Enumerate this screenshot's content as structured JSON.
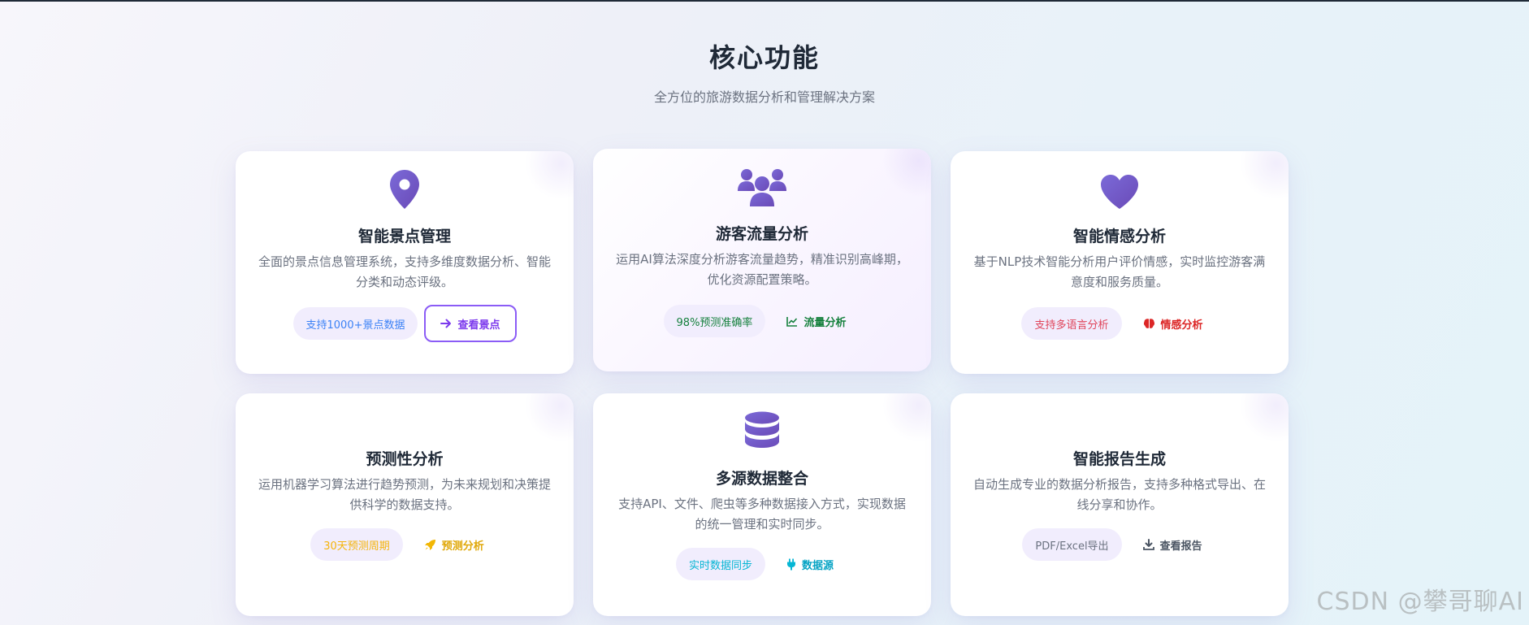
{
  "header": {
    "title": "核心功能",
    "subtitle": "全方位的旅游数据分析和管理解决方案"
  },
  "features": [
    {
      "title": "智能景点管理",
      "description": "全面的景点信息管理系统，支持多维度数据分析、智能分类和动态评级。",
      "icon": "map-pin-icon",
      "badge": "支持1000+景点数据",
      "badge_color": "#3b82f6",
      "action_icon": "arrow-right-icon",
      "action_label": "查看景点",
      "action_color": "#7c3aed"
    },
    {
      "title": "游客流量分析",
      "description": "运用AI算法深度分析游客流量趋势，精准识别高峰期，优化资源配置策略。",
      "icon": "users-icon",
      "badge": "98%预测准确率",
      "badge_color": "#15803d",
      "action_icon": "line-chart-icon",
      "action_label": "流量分析",
      "action_color": "#15803d"
    },
    {
      "title": "智能情感分析",
      "description": "基于NLP技术智能分析用户评价情感，实时监控游客满意度和服务质量。",
      "icon": "heart-icon",
      "badge": "支持多语言分析",
      "badge_color": "#e0445a",
      "action_icon": "brain-icon",
      "action_label": "情感分析",
      "action_color": "#dc2626"
    },
    {
      "title": "预测性分析",
      "description": "运用机器学习算法进行趋势预测，为未来规划和决策提供科学的数据支持。",
      "icon": "none",
      "badge": "30天预测周期",
      "badge_color": "#f5b40b",
      "action_icon": "rocket-icon",
      "action_label": "预测分析",
      "action_color": "#e0a80a"
    },
    {
      "title": "多源数据整合",
      "description": "支持API、文件、爬虫等多种数据接入方式，实现数据的统一管理和实时同步。",
      "icon": "database-icon",
      "badge": "实时数据同步",
      "badge_color": "#06b6d4",
      "action_icon": "plug-icon",
      "action_label": "数据源",
      "action_color": "#06a3c4"
    },
    {
      "title": "智能报告生成",
      "description": "自动生成专业的数据分析报告，支持多种格式导出、在线分享和协作。",
      "icon": "none",
      "badge": "PDF/Excel导出",
      "badge_color": "#6b7280",
      "action_icon": "download-icon",
      "action_label": "查看报告",
      "action_color": "#4b5563"
    }
  ],
  "colors": {
    "accent": "#7c5fd4",
    "accent_dark": "#5b46b8"
  },
  "watermark": "CSDN @攀哥聊AI"
}
